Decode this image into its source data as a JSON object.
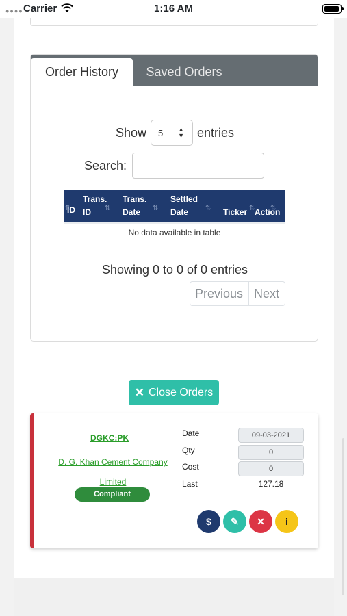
{
  "status_bar": {
    "carrier": "Carrier",
    "time": "1:16 AM"
  },
  "tabs": [
    {
      "label": "Order History",
      "active": true
    },
    {
      "label": "Saved Orders",
      "active": false
    }
  ],
  "length_control": {
    "prefix": "Show",
    "value": "5",
    "suffix": "entries"
  },
  "search": {
    "label": "Search:",
    "value": ""
  },
  "table": {
    "columns": [
      {
        "line1": "",
        "line2": "ID"
      },
      {
        "line1": "Trans.",
        "line2": "ID"
      },
      {
        "line1": "Trans.",
        "line2": "Date"
      },
      {
        "line1": "Settled",
        "line2": "Date"
      },
      {
        "line1": "",
        "line2": "Ticker"
      },
      {
        "line1": "",
        "line2": "Action"
      }
    ],
    "empty_message": "No data available in table",
    "info": "Showing 0 to 0 of 0 entries",
    "pagination": {
      "previous": "Previous",
      "next": "Next"
    }
  },
  "close_orders_button": {
    "label": "Close Orders",
    "icon": "close-x-icon"
  },
  "order": {
    "ticker": "DGKC:PK",
    "company_line1": "D. G. Khan Cement Company",
    "company_line2": "Limited",
    "status_badge": "Compliant",
    "fields": {
      "date_label": "Date",
      "date_value": "09-03-2021",
      "qty_label": "Qty",
      "qty_value": "0",
      "cost_label": "Cost",
      "cost_value": "0",
      "last_label": "Last",
      "last_value": "127.18"
    },
    "actions": [
      {
        "name": "buy",
        "icon": "dollar-icon",
        "glyph": "$",
        "color": "#1f3a6e"
      },
      {
        "name": "edit",
        "icon": "pencil-icon",
        "glyph": "✎",
        "color": "#2fbfa8"
      },
      {
        "name": "delete",
        "icon": "close-icon",
        "glyph": "✕",
        "color": "#dc3545"
      },
      {
        "name": "info",
        "icon": "info-icon",
        "glyph": "i",
        "color": "#f5c518"
      }
    ]
  },
  "colors": {
    "tab_bar": "#656d72",
    "table_header": "#1f3a6e",
    "accent_teal": "#2fbfa8",
    "card_border_red": "#c8313b",
    "link_green": "#2a9d2a",
    "badge_green": "#2f8c3c"
  }
}
